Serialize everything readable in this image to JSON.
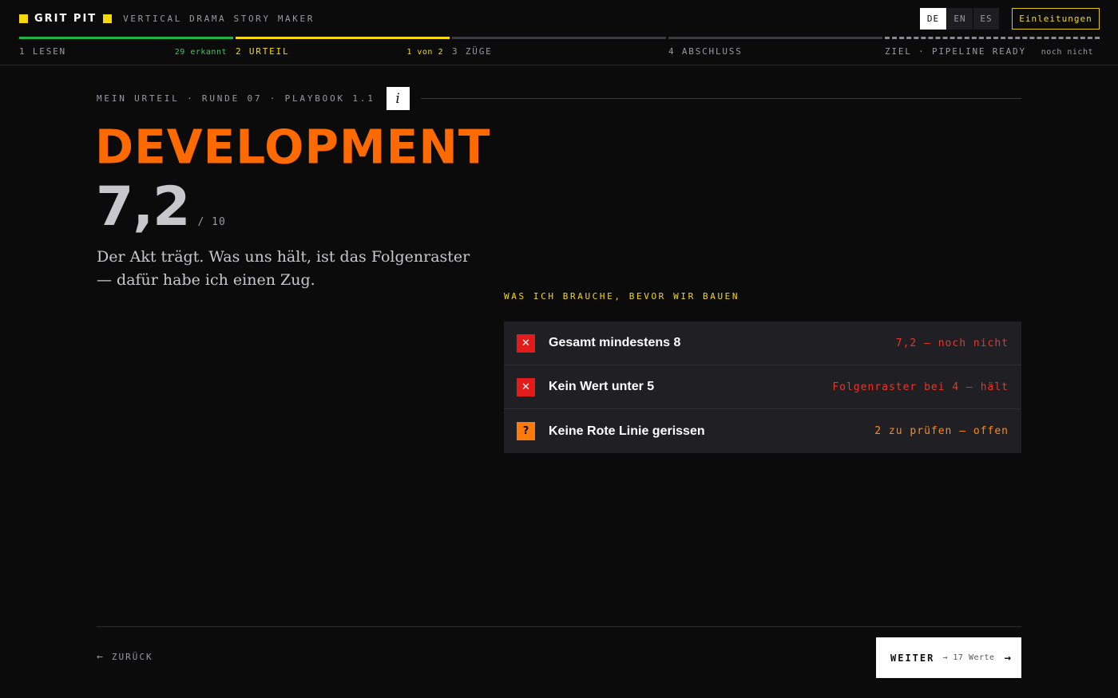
{
  "header": {
    "brand_name": "GRIT PIT",
    "tagline": "VERTICAL DRAMA STORY MAKER",
    "languages": [
      {
        "label": "DE",
        "active": true
      },
      {
        "label": "EN",
        "active": false
      },
      {
        "label": "ES",
        "active": false
      }
    ],
    "guide_label": "Einleitungen",
    "steps": [
      {
        "label": "1 LESEN",
        "meta": "29 erkannt",
        "state": "done",
        "bar_color": "#22b24a",
        "meta_color": "#3ec85e"
      },
      {
        "label": "2 URTEIL",
        "meta": "1 von 2",
        "state": "active",
        "bar_color": "#f5d90a",
        "meta_color": "#f5d90a"
      },
      {
        "label": "3 ZÜGE",
        "meta": "",
        "state": "todo",
        "bar_color": "#3a3a3f",
        "meta_color": "#9a9aa0"
      },
      {
        "label": "4 ABSCHLUSS",
        "meta": "",
        "state": "todo",
        "bar_color": "#3a3a3f",
        "meta_color": "#9a9aa0"
      },
      {
        "label": "ZIEL · PIPELINE READY",
        "meta": "noch nicht",
        "state": "goal",
        "bar_color": "#8a8a90",
        "meta_color": "#9a9aa0"
      }
    ]
  },
  "main": {
    "breadcrumb": "MEIN URTEIL · RUNDE 07 · PLAYBOOK 1.1",
    "info_label": "i",
    "title": "DEVELOPMENT",
    "score": "7,2",
    "score_max": "/ 10",
    "quote": "Der Akt trägt. Was uns hält, ist das Folgenraster — dafür habe ich einen Zug.",
    "requirements_title": "WAS ICH BRAUCHE, BEVOR WIR BAUEN",
    "requirements": [
      {
        "icon": "✕",
        "icon_name": "fail-icon",
        "kind": "fail",
        "label": "Gesamt mindestens 8",
        "status": "7,2 — noch nicht",
        "status_color": "red"
      },
      {
        "icon": "✕",
        "icon_name": "fail-icon",
        "kind": "fail",
        "label": "Kein Wert unter 5",
        "status": "Folgenraster bei 4 — hält",
        "status_color": "red"
      },
      {
        "icon": "?",
        "icon_name": "question-icon",
        "kind": "open",
        "label": "Keine Rote Linie gerissen",
        "status": "2 zu prüfen — offen",
        "status_color": "orange"
      }
    ]
  },
  "footer": {
    "back_arrow": "←",
    "back_label": "ZURÜCK",
    "next_label": "WEITER",
    "next_meta": "→ 17 Werte",
    "next_arrow": "→"
  },
  "colors": {
    "accent_orange": "#ff6a00",
    "accent_yellow": "#f5d90a",
    "fail_red": "#e21b1b",
    "background": "#0b0b0c"
  }
}
